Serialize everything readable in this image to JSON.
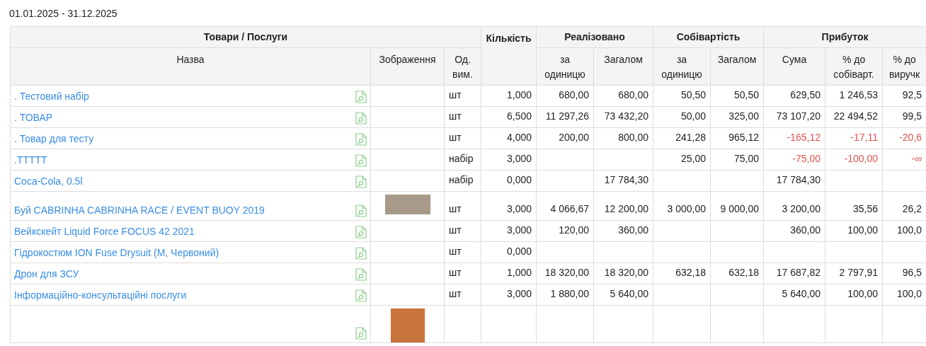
{
  "period": "01.01.2025 - 31.12.2025",
  "header_groups": [
    "Товари / Послуги",
    "Кількість",
    "Реалізовано",
    "Собівартість",
    "Прибуток"
  ],
  "columns": [
    "Назва",
    "Зображення",
    "Од. вим.",
    "за одиницю",
    "Загалом",
    "за одиницю",
    "Загалом",
    "Сума",
    "% до собіварт.",
    "% до виручк"
  ],
  "rows": [
    {
      "name": ". Тестовий набір",
      "has_photo": false,
      "unit": "шт",
      "qty": "1,000",
      "sold_unit": "680,00",
      "sold_total": "680,00",
      "cost_unit": "50,50",
      "cost_total": "50,50",
      "profit": "629,50",
      "pct_cost": "1 246,53",
      "pct_rev": "92,5",
      "loss": false
    },
    {
      "name": ". ТОВАР",
      "has_photo": false,
      "unit": "шт",
      "qty": "6,500",
      "sold_unit": "11 297,26",
      "sold_total": "73 432,20",
      "cost_unit": "50,00",
      "cost_total": "325,00",
      "profit": "73 107,20",
      "pct_cost": "22 494,52",
      "pct_rev": "99,5",
      "loss": false
    },
    {
      "name": ". Товар для тесту",
      "has_photo": false,
      "unit": "шт",
      "qty": "4,000",
      "sold_unit": "200,00",
      "sold_total": "800,00",
      "cost_unit": "241,28",
      "cost_total": "965,12",
      "profit": "-165,12",
      "pct_cost": "-17,11",
      "pct_rev": "-20,6",
      "loss": true
    },
    {
      "name": ".ТТТТТ",
      "has_photo": false,
      "unit": "набір",
      "qty": "3,000",
      "cost_unit": "25,00",
      "cost_total": "75,00",
      "profit": "-75,00",
      "pct_cost": "-100,00",
      "pct_rev": "-∞",
      "loss": true
    },
    {
      "name": "Coca-Cola, 0.5l",
      "has_photo": false,
      "unit": "набір",
      "qty": "0,000",
      "sold_total": "17 784,30",
      "profit": "17 784,30",
      "loss": false
    },
    {
      "name": "Буй CABRINHA CABRINHA RACE / EVENT BUOY 2019",
      "has_photo": true,
      "unit": "шт",
      "qty": "3,000",
      "sold_unit": "4 066,67",
      "sold_total": "12 200,00",
      "cost_unit": "3 000,00",
      "cost_total": "9 000,00",
      "profit": "3 200,00",
      "pct_cost": "35,56",
      "pct_rev": "26,2",
      "loss": false
    },
    {
      "name": "Вейкскейт Liquid Force FOCUS 42 2021",
      "has_photo": false,
      "unit": "шт",
      "qty": "3,000",
      "sold_unit": "120,00",
      "sold_total": "360,00",
      "profit": "360,00",
      "pct_cost": "100,00",
      "pct_rev": "100,0",
      "loss": false
    },
    {
      "name": "Гідрокостюм ION Fuse Drysuit (M, Червоний)",
      "has_photo": false,
      "unit": "шт",
      "qty": "0,000"
    },
    {
      "name": "Дрон для ЗСУ",
      "has_photo": false,
      "unit": "шт",
      "qty": "1,000",
      "sold_unit": "18 320,00",
      "sold_total": "18 320,00",
      "cost_unit": "632,18",
      "cost_total": "632,18",
      "profit": "17 687,82",
      "pct_cost": "2 797,91",
      "pct_rev": "96,5",
      "loss": false
    },
    {
      "name": "Інформаційно-консультаційні послуги",
      "has_photo": false,
      "unit": "шт",
      "qty": "3,000",
      "sold_unit": "1 880,00",
      "sold_total": "5 640,00",
      "profit": "5 640,00",
      "pct_cost": "100,00",
      "pct_rev": "100,0",
      "loss": false
    },
    {
      "has_photo": true
    }
  ]
}
